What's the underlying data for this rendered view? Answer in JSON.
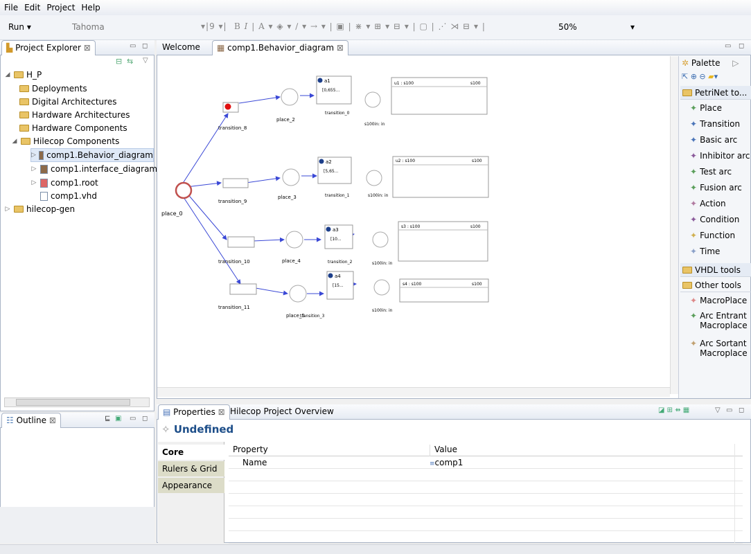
{
  "menu": [
    "File",
    "Edit",
    "Project",
    "Help"
  ],
  "toolbar": {
    "run_label": "Run",
    "font_name": "Tahoma",
    "font_size": "9",
    "zoom": "50%"
  },
  "project_explorer": {
    "tab": "Project Explorer",
    "items": [
      {
        "label": "H_P"
      },
      {
        "label": "Deployments"
      },
      {
        "label": "Digital Architectures"
      },
      {
        "label": "Hardware Architectures"
      },
      {
        "label": "Hardware Components"
      },
      {
        "label": "Hilecop Components"
      },
      {
        "label": "comp1.Behavior_diagram"
      },
      {
        "label": "comp1.interface_diagram"
      },
      {
        "label": "comp1.root"
      },
      {
        "label": "comp1.vhd"
      },
      {
        "label": "hilecop-gen"
      }
    ]
  },
  "outline": {
    "tab": "Outline"
  },
  "editor_tabs": {
    "welcome": "Welcome",
    "diagram": "comp1.Behavior_diagram"
  },
  "diagram": {
    "place0": "place_0",
    "places": [
      "place_2",
      "place_3",
      "place_4",
      "place_5"
    ],
    "transitions": [
      "transition_8",
      "transition_9",
      "transition_10",
      "transition_11"
    ],
    "actions": [
      {
        "name": "a1",
        "val": "[0,655..."
      },
      {
        "name": "a2",
        "val": "[5,65..."
      },
      {
        "name": "a3",
        "val": "[10..."
      },
      {
        "name": "a4",
        "val": "[15..."
      }
    ],
    "inner_transitions": [
      "transition_0",
      "transition_1",
      "transition_2",
      "transition_3"
    ],
    "components": [
      {
        "name": "u1 : s100",
        "port": "s100"
      },
      {
        "name": "u2 : s100",
        "port": "s100"
      },
      {
        "name": "s3 : s100",
        "port": "s100"
      },
      {
        "name": "s4 : s100",
        "port": "s100"
      }
    ],
    "port_label": "s100in: in"
  },
  "palette": {
    "title": "Palette",
    "petri_header": "PetriNet to...",
    "items": [
      "Place",
      "Transition",
      "Basic arc",
      "Inhibitor arc",
      "Test arc",
      "Fusion arc",
      "Action",
      "Condition",
      "Function",
      "Time"
    ],
    "vhdl_header": "VHDL tools",
    "other_header": "Other tools",
    "other_items": [
      "MacroPlace",
      "Arc Entrant Macroplace",
      "Arc Sortant Macroplace"
    ]
  },
  "properties": {
    "tab": "Properties",
    "tab2": "Hilecop Project Overview",
    "title": "Undefined",
    "sidetabs": [
      "Core",
      "Rulers & Grid",
      "Appearance"
    ],
    "col_property": "Property",
    "col_value": "Value",
    "rows": [
      {
        "name": "Name",
        "value": "comp1"
      }
    ]
  },
  "colors": {
    "accent": "#1d4e89",
    "token": "#e01010",
    "place0": "#c0504d",
    "arc": "#3a48d6"
  }
}
